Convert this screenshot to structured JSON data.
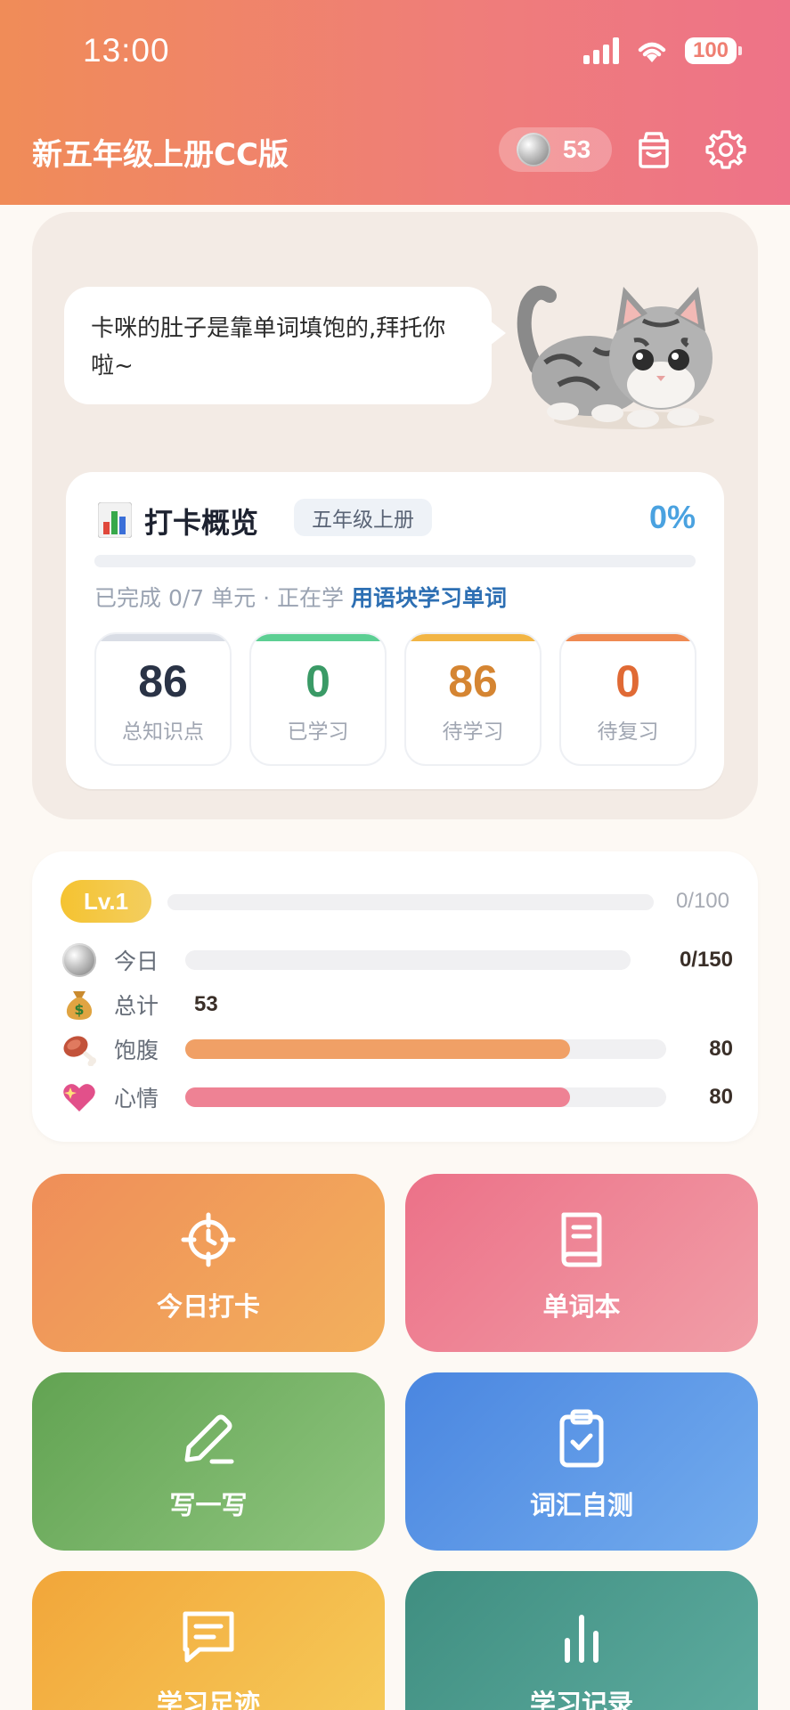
{
  "status": {
    "time": "13:00",
    "battery": "100"
  },
  "header": {
    "title": "新五年级上册CC版",
    "coins": "53"
  },
  "pet": {
    "speech": "卡咪的肚子是靠单词填饱的,拜托你啦~"
  },
  "checkin": {
    "title": "打卡概览",
    "grade_tag": "五年级上册",
    "percent_label": "0%",
    "progress": 0,
    "progress_text": "已完成 0/7 单元 · 正在学",
    "current_unit": "用语块学习单词",
    "stats": [
      {
        "value": "86",
        "label": "总知识点",
        "color": "#2a3346",
        "bar": "#d9dde5"
      },
      {
        "value": "0",
        "label": "已学习",
        "color": "#3a9a66",
        "bar": "#5ccf93"
      },
      {
        "value": "86",
        "label": "待学习",
        "color": "#d58532",
        "bar": "#f2b545"
      },
      {
        "value": "0",
        "label": "待复习",
        "color": "#e06a35",
        "bar": "#ef8a52"
      }
    ]
  },
  "level": {
    "badge": "Lv.1",
    "exp": "0/100",
    "exp_progress": 0,
    "rows": [
      {
        "icon": "silver-coin-icon",
        "label": "今日",
        "value": "0/150",
        "progress": 0,
        "color": "#f09a68"
      },
      {
        "icon": "money-bag-icon",
        "label": "总计",
        "value": "53"
      },
      {
        "icon": "meat-icon",
        "label": "饱腹",
        "value": "80",
        "progress": 0.8,
        "color": "#f0a066"
      },
      {
        "icon": "heart-icon",
        "label": "心情",
        "value": "80",
        "progress": 0.8,
        "color": "#ee8294"
      }
    ]
  },
  "actions": [
    {
      "label": "今日打卡",
      "icon": "target-icon"
    },
    {
      "label": "单词本",
      "icon": "book-icon"
    },
    {
      "label": "写一写",
      "icon": "pen-icon"
    },
    {
      "label": "词汇自测",
      "icon": "clipboard-check-icon"
    },
    {
      "label": "学习足迹",
      "icon": "message-icon"
    },
    {
      "label": "学习记录",
      "icon": "bar-chart-icon"
    }
  ]
}
